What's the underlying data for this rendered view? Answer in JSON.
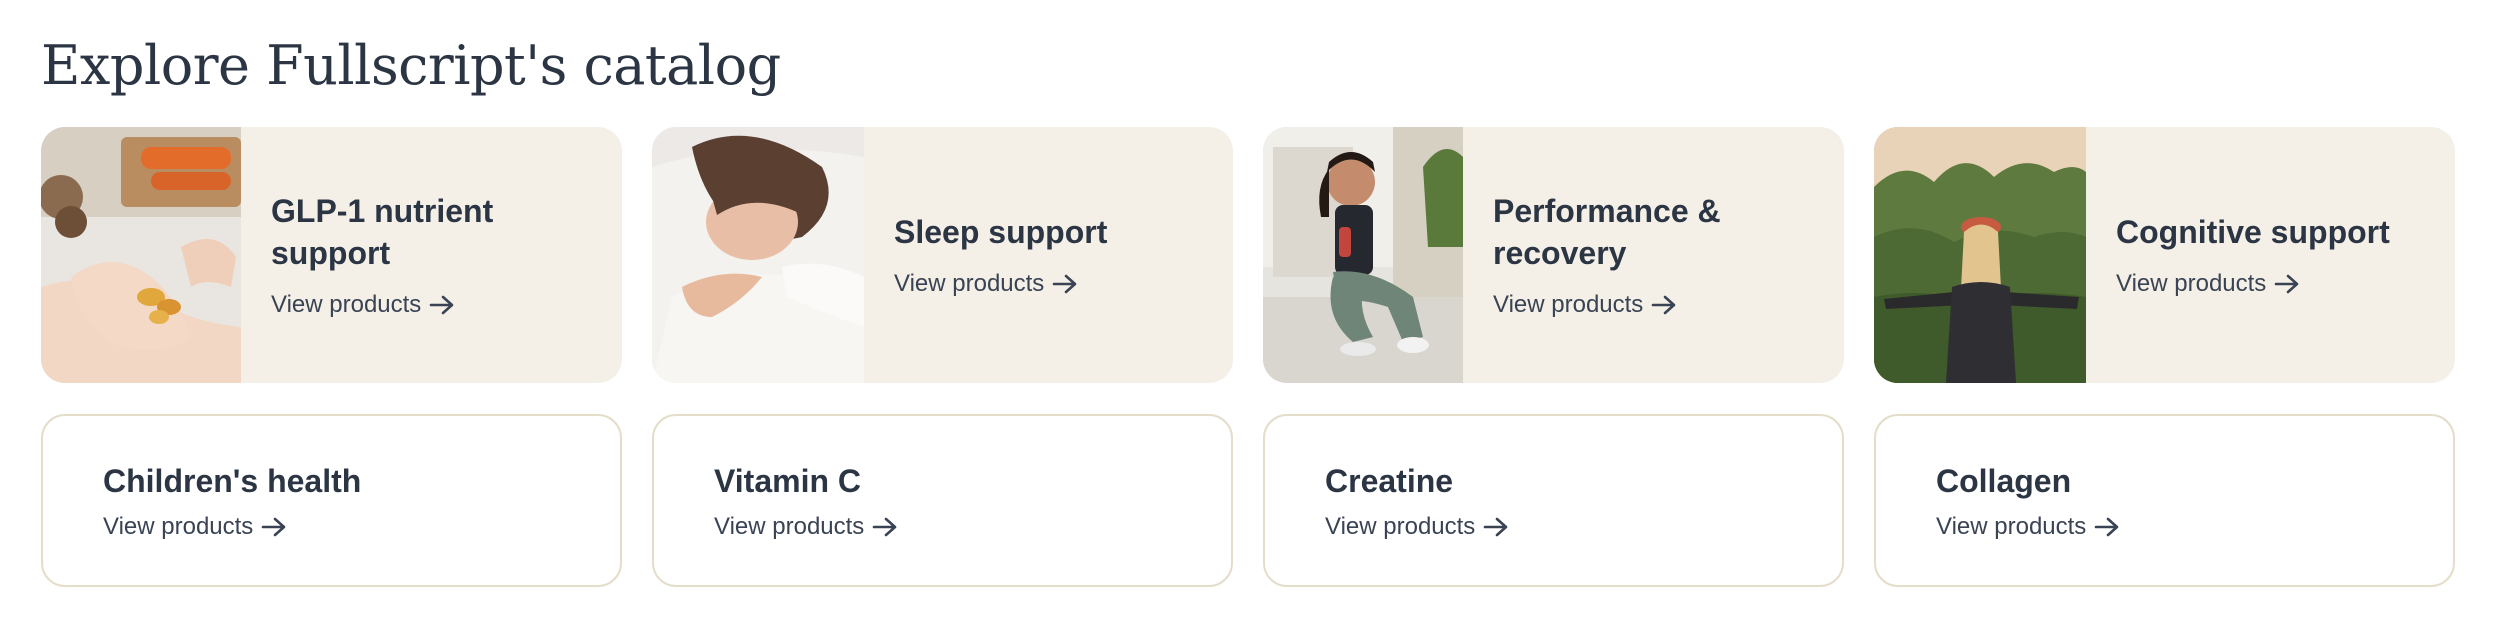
{
  "section": {
    "title": "Explore Fullscript's catalog"
  },
  "featured_cards": [
    {
      "title": "GLP-1 nutrient support",
      "link": "View products",
      "image": "hand-holding-softgel-capsules-photo"
    },
    {
      "title": "Sleep support",
      "link": "View products",
      "image": "woman-sleeping-on-pillow-photo"
    },
    {
      "title": "Performance & recovery",
      "link": "View products",
      "image": "woman-sitting-with-drink-photo"
    },
    {
      "title": "Cognitive support",
      "link": "View products",
      "image": "woman-arms-outstretched-forest-photo"
    }
  ],
  "plain_cards": [
    {
      "title": "Children's health",
      "link": "View products"
    },
    {
      "title": "Vitamin C",
      "link": "View products"
    },
    {
      "title": "Creatine",
      "link": "View products"
    },
    {
      "title": "Collagen",
      "link": "View products"
    }
  ],
  "colors": {
    "text": "#2b3544",
    "card_bg": "#f4f0e7",
    "card_border": "#e4ddca"
  },
  "icons": {
    "link_arrow": "arrow-right-icon"
  }
}
